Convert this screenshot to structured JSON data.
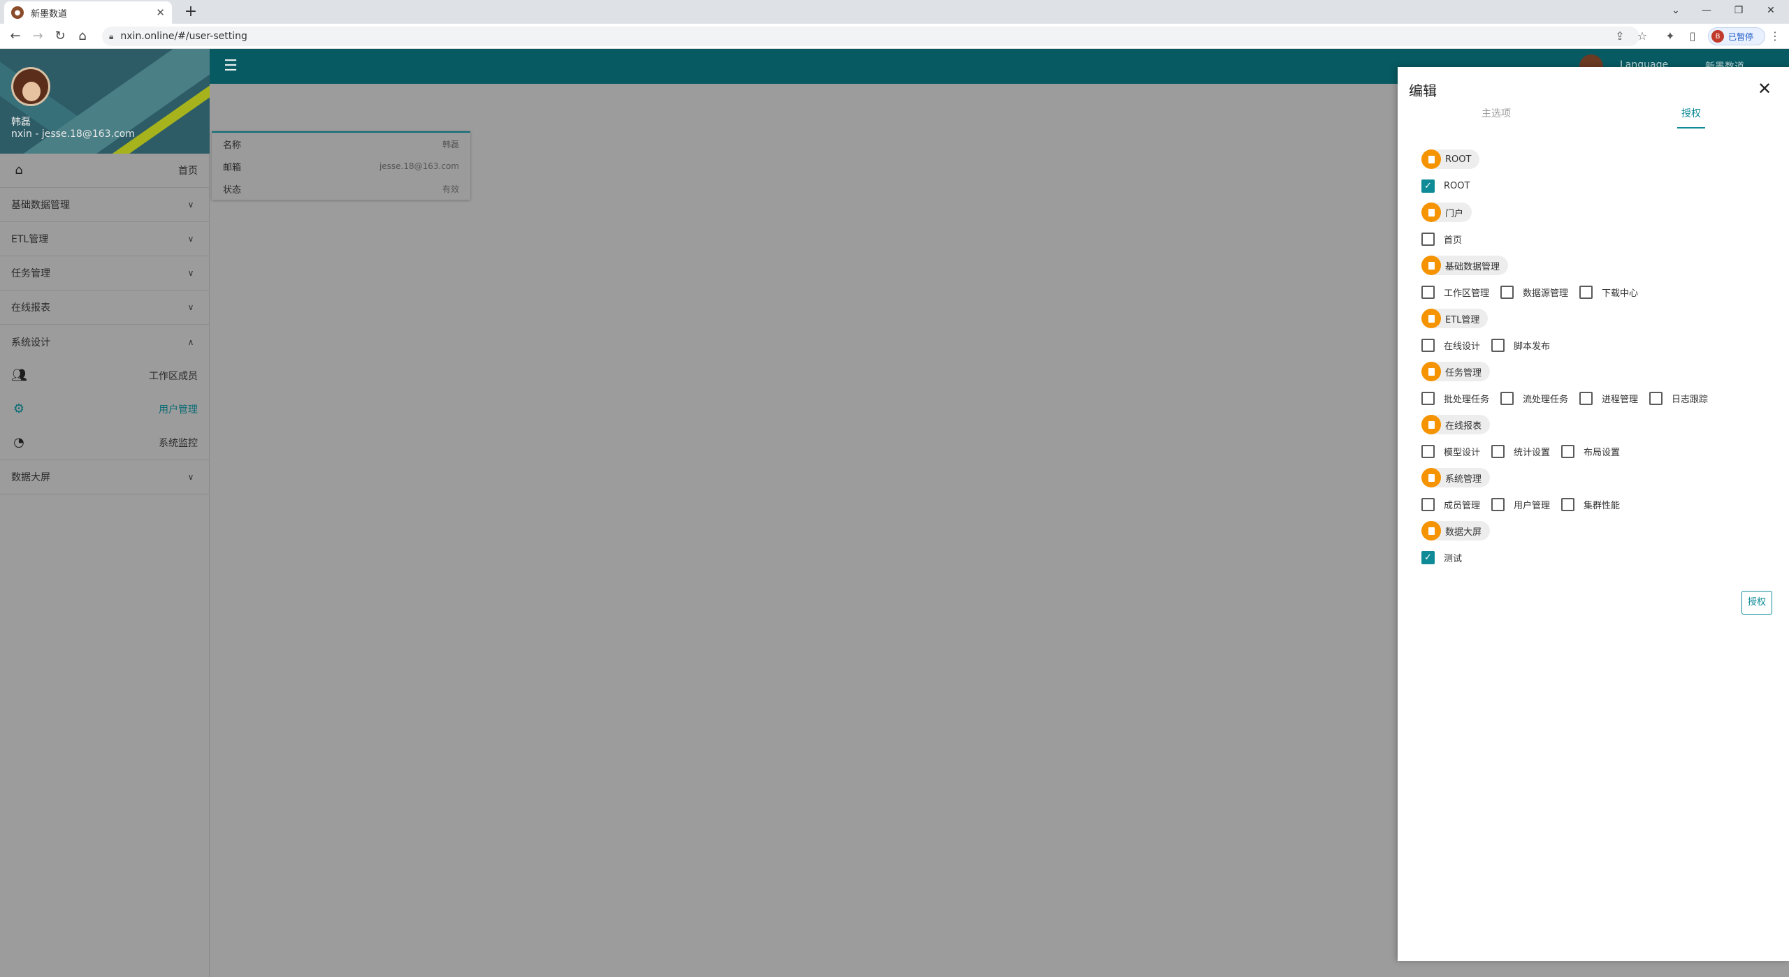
{
  "browser": {
    "tab_title": "新墨数道",
    "url": "nxin.online/#/user-setting",
    "profile_status": "已暂停",
    "profile_initial": "B"
  },
  "appbar": {
    "user_name": "Language",
    "brand": "新墨数道"
  },
  "profile": {
    "name": "韩磊",
    "email": "nxin - jesse.18@163.com"
  },
  "nav": {
    "home": "首页",
    "groups": [
      {
        "label": "基础数据管理"
      },
      {
        "label": "ETL管理"
      },
      {
        "label": "任务管理"
      },
      {
        "label": "在线报表"
      }
    ],
    "system_design": {
      "label": "系统设计",
      "children": [
        {
          "label": "工作区成员",
          "icon": "people-icon"
        },
        {
          "label": "用户管理",
          "icon": "gear-icon"
        },
        {
          "label": "系统监控",
          "icon": "gauge-icon"
        }
      ]
    },
    "data_screen": "数据大屏"
  },
  "info_card": {
    "rows": [
      {
        "key": "名称",
        "value": "韩磊"
      },
      {
        "key": "邮箱",
        "value": "jesse.18@163.com"
      },
      {
        "key": "状态",
        "value": "有效"
      }
    ]
  },
  "drawer": {
    "title": "编辑",
    "tabs": {
      "main": "主选项",
      "grant": "授权"
    },
    "groups": [
      {
        "name": "ROOT",
        "items": [
          {
            "label": "ROOT",
            "checked": true
          }
        ]
      },
      {
        "name": "门户",
        "items": [
          {
            "label": "首页",
            "checked": false
          }
        ]
      },
      {
        "name": "基础数据管理",
        "items": [
          {
            "label": "工作区管理",
            "checked": false
          },
          {
            "label": "数据源管理",
            "checked": false
          },
          {
            "label": "下载中心",
            "checked": false
          }
        ]
      },
      {
        "name": "ETL管理",
        "items": [
          {
            "label": "在线设计",
            "checked": false
          },
          {
            "label": "脚本发布",
            "checked": false
          }
        ]
      },
      {
        "name": "任务管理",
        "items": [
          {
            "label": "批处理任务",
            "checked": false
          },
          {
            "label": "流处理任务",
            "checked": false
          },
          {
            "label": "进程管理",
            "checked": false
          },
          {
            "label": "日志跟踪",
            "checked": false
          }
        ]
      },
      {
        "name": "在线报表",
        "items": [
          {
            "label": "模型设计",
            "checked": false
          },
          {
            "label": "统计设置",
            "checked": false
          },
          {
            "label": "布局设置",
            "checked": false
          }
        ]
      },
      {
        "name": "系统管理",
        "items": [
          {
            "label": "成员管理",
            "checked": false
          },
          {
            "label": "用户管理",
            "checked": false
          },
          {
            "label": "集群性能",
            "checked": false
          }
        ]
      },
      {
        "name": "数据大屏",
        "items": [
          {
            "label": "测试",
            "checked": true
          }
        ]
      }
    ],
    "grant_button": "授权"
  }
}
